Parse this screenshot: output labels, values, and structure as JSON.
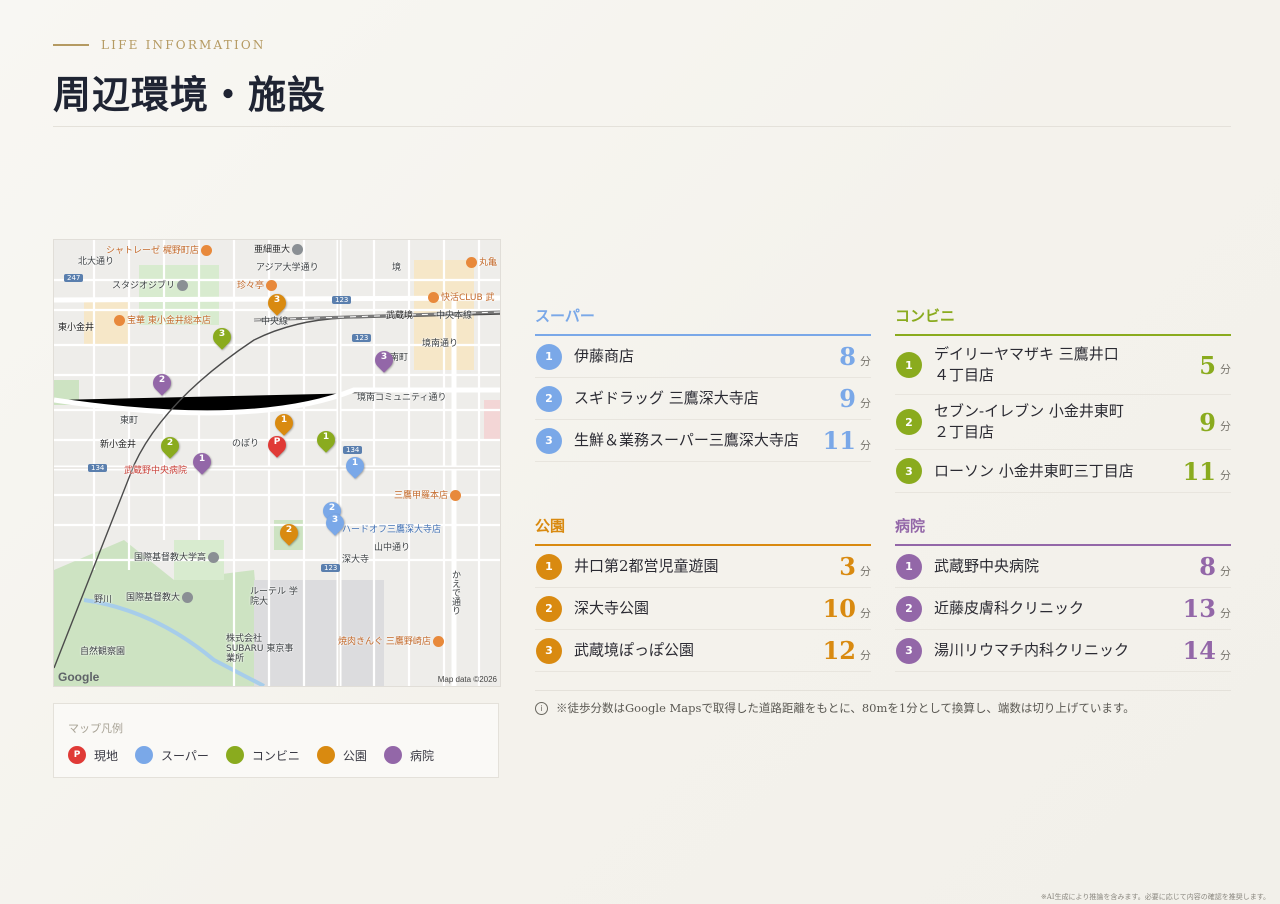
{
  "header": {
    "eyebrow": "LIFE INFORMATION",
    "title": "周辺環境・施設"
  },
  "colors": {
    "gold": "#b59a62",
    "super": "#7aa8e8",
    "conveni": "#8aab1e",
    "park": "#d98a10",
    "hospital": "#9367a8",
    "site": "#e03a36"
  },
  "map": {
    "credit": "Map data ©2026",
    "google": "Google",
    "labels": {
      "chateraise": "シャトレーゼ 梶野町店",
      "asia_univ": "亜細亜大",
      "asia_dori": "アジア大学通り",
      "kitaoodori": "北大通り",
      "ghibli": "スタジオジブリ",
      "chinchin": "珍々亭",
      "hoka": "宝華 東小金井総本店",
      "higashikoganei": "東小金井",
      "kaikatsu": "快活CLUB 武",
      "musashisakai": "武蔵境",
      "chuo_line": "中央線",
      "chuo_honsen": "中央本線",
      "marugame": "丸亀",
      "minamicho": "南町",
      "kyonan": "境南通り",
      "kyonan_comm": "境南コミュニティ通り",
      "higashicho": "東町",
      "shinkoganei": "新小金井",
      "noborinoki": "のぼり",
      "musashino_hosp": "武蔵野中央病院",
      "mitaka_kouya": "三鷹甲羅本店",
      "hardoff": "ハードオフ三鷹深大寺店",
      "icu_hs": "国際基督教大学高",
      "jindaiji": "深大寺",
      "yamanaka": "山中通り",
      "icu": "国際基督教大",
      "lutheran": "ルーテル 学院大",
      "subaru": "株式会社SUBARU 東京事業所",
      "yakiniku": "焼肉きんぐ 三鷹野崎店",
      "shizen": "自然観察園",
      "nogawa": "野川",
      "kaede": "かえで通り",
      "sakai": "境"
    },
    "road_numbers": [
      "247",
      "123",
      "123",
      "134",
      "134",
      "123"
    ]
  },
  "legend": {
    "title": "マップ凡例",
    "items": [
      {
        "icon": "P",
        "label": "現地",
        "color": "#e03a36"
      },
      {
        "icon": "",
        "label": "スーパー",
        "color": "#7aa8e8"
      },
      {
        "icon": "",
        "label": "コンビニ",
        "color": "#8aab1e"
      },
      {
        "icon": "",
        "label": "公園",
        "color": "#d98a10"
      },
      {
        "icon": "",
        "label": "病院",
        "color": "#9367a8"
      }
    ]
  },
  "categories": {
    "super": {
      "title": "スーパー",
      "items": [
        {
          "no": "1",
          "name": "伊藤商店",
          "min": "8",
          "unit": "分"
        },
        {
          "no": "2",
          "name": "スギドラッグ 三鷹深大寺店",
          "min": "9",
          "unit": "分"
        },
        {
          "no": "3",
          "name": "生鮮＆業務スーパー三鷹深大寺店",
          "min": "11",
          "unit": "分"
        }
      ]
    },
    "conveni": {
      "title": "コンビニ",
      "items": [
        {
          "no": "1",
          "name": "デイリーヤマザキ 三鷹井口\n４丁目店",
          "min": "5",
          "unit": "分"
        },
        {
          "no": "2",
          "name": "セブン-イレブン 小金井東町\n２丁目店",
          "min": "9",
          "unit": "分"
        },
        {
          "no": "3",
          "name": "ローソン 小金井東町三丁目店",
          "min": "11",
          "unit": "分"
        }
      ]
    },
    "park": {
      "title": "公園",
      "items": [
        {
          "no": "1",
          "name": "井口第2都営児童遊園",
          "min": "3",
          "unit": "分"
        },
        {
          "no": "2",
          "name": "深大寺公園",
          "min": "10",
          "unit": "分"
        },
        {
          "no": "3",
          "name": "武蔵境ぽっぽ公園",
          "min": "12",
          "unit": "分"
        }
      ]
    },
    "hospital": {
      "title": "病院",
      "items": [
        {
          "no": "1",
          "name": "武蔵野中央病院",
          "min": "8",
          "unit": "分"
        },
        {
          "no": "2",
          "name": "近藤皮膚科クリニック",
          "min": "13",
          "unit": "分"
        },
        {
          "no": "3",
          "name": "湯川リウマチ内科クリニック",
          "min": "14",
          "unit": "分"
        }
      ]
    }
  },
  "note": {
    "icon": "i",
    "text": "※徒歩分数はGoogle Mapsで取得した道路距離をもとに、80mを1分として換算し、端数は切り上げています。"
  },
  "disclaimer": "※AI生成により推論を含みます。必要に応じて内容の確認を推奨します。"
}
